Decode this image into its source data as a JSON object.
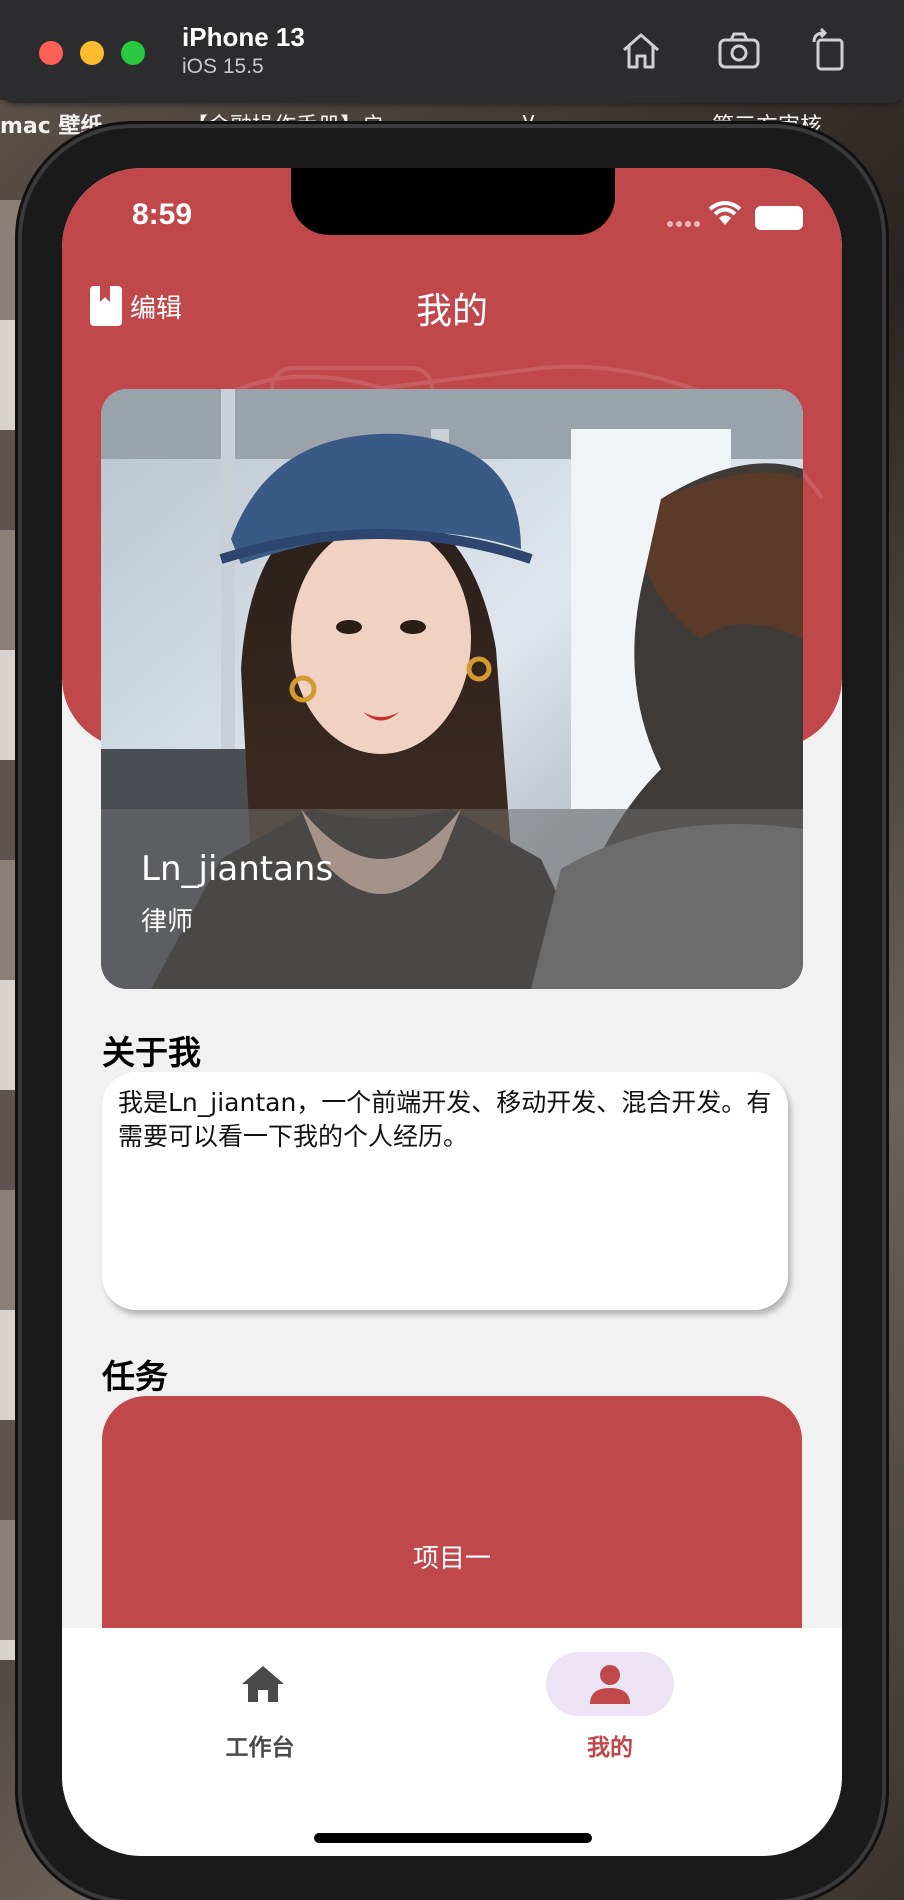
{
  "simulator": {
    "device_name": "iPhone 13",
    "os_version": "iOS 15.5"
  },
  "desktop": {
    "label_1": "mac 壁纸",
    "label_2": "【金融操作手册】启",
    "label_3": "v",
    "label_4": "第三方审核"
  },
  "status_bar": {
    "time": "8:59"
  },
  "nav": {
    "edit_label": "编辑",
    "title": "我的"
  },
  "profile": {
    "name": "Ln_jiantans",
    "role": "律师"
  },
  "about": {
    "title": "关于我",
    "text": "我是Ln_jiantan，一个前端开发、移动开发、混合开发。有需要可以看一下我的个人经历。"
  },
  "tasks": {
    "title": "任务",
    "items": [
      {
        "label": "项目一"
      }
    ]
  },
  "tabbar": {
    "items": [
      {
        "label": "工作台",
        "icon": "home-icon",
        "active": false
      },
      {
        "label": "我的",
        "icon": "person-icon",
        "active": true
      }
    ]
  },
  "colors": {
    "accent": "#c0484b",
    "tab_active_bg": "#ece3f4",
    "tab_inactive": "#4a4a4a"
  }
}
